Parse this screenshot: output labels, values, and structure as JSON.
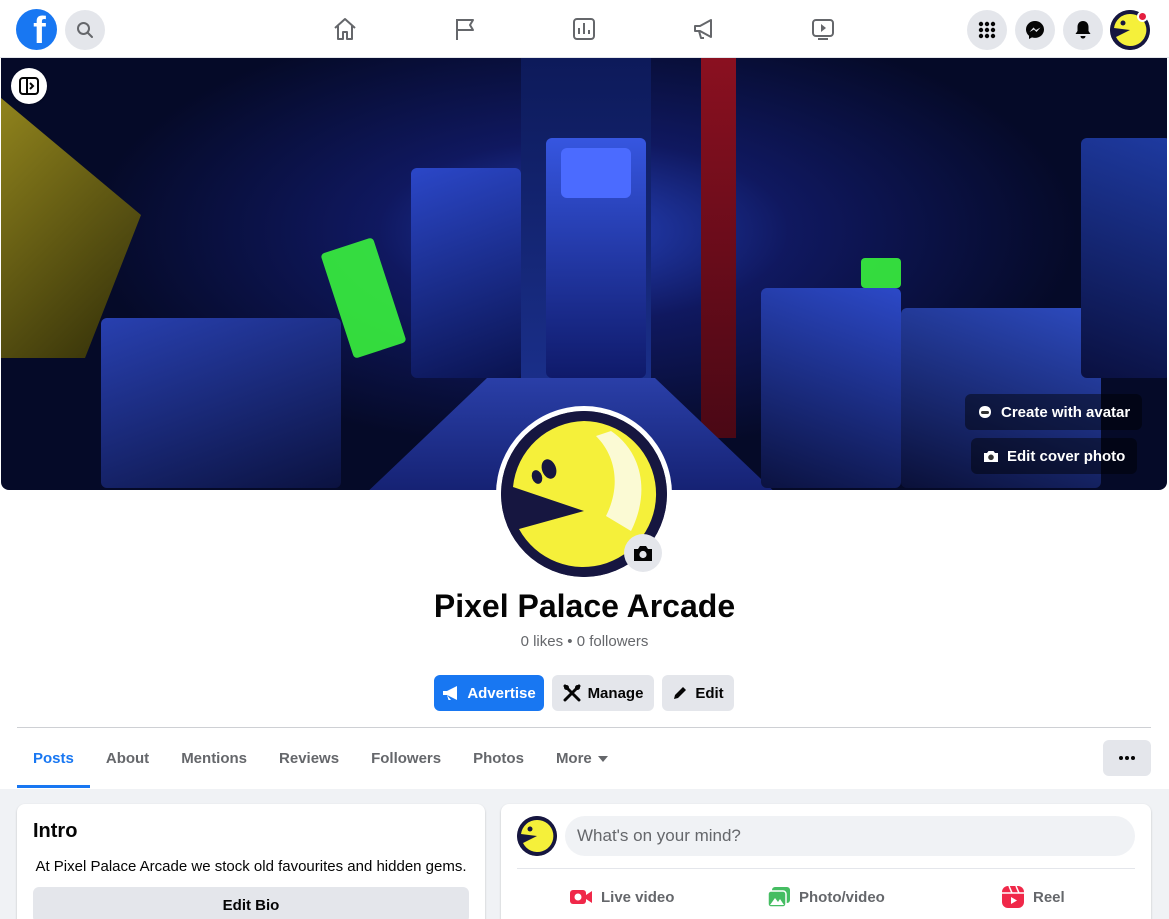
{
  "topnav": {
    "logo_letter": "f",
    "icons": [
      "home-icon",
      "flag-icon",
      "insights-icon",
      "megaphone-icon",
      "video-icon"
    ],
    "right_icons": [
      "menu-grid-icon",
      "messenger-icon",
      "bell-icon"
    ]
  },
  "cover": {
    "create_avatar_label": "Create with avatar",
    "edit_cover_label": "Edit cover photo"
  },
  "profile": {
    "name": "Pixel Palace Arcade",
    "stats": "0 likes • 0 followers"
  },
  "actions": {
    "advertise": "Advertise",
    "manage": "Manage",
    "edit": "Edit"
  },
  "tabs": [
    {
      "label": "Posts",
      "active": true
    },
    {
      "label": "About"
    },
    {
      "label": "Mentions"
    },
    {
      "label": "Reviews"
    },
    {
      "label": "Followers"
    },
    {
      "label": "Photos"
    },
    {
      "label": "More"
    }
  ],
  "intro": {
    "title": "Intro",
    "bio": "At Pixel Palace Arcade we stock old favourites and hidden gems.",
    "edit_bio": "Edit Bio"
  },
  "composer": {
    "placeholder": "What's on your mind?",
    "live_video": "Live video",
    "photo_video": "Photo/video",
    "reel": "Reel"
  },
  "colors": {
    "brand": "#1877f2",
    "live": "#f02849",
    "photo": "#45bd62",
    "reel": "#f02849"
  }
}
